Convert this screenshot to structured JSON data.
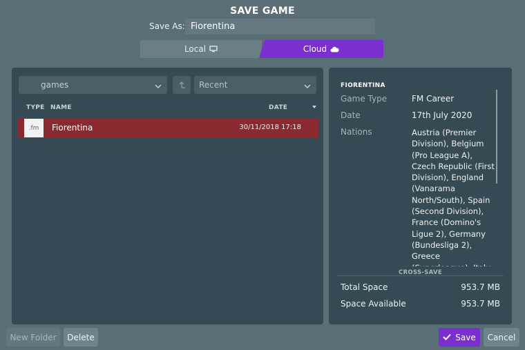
{
  "dialog": {
    "title": "SAVE GAME",
    "save_as_label": "Save As:",
    "save_as_value": "Fiorentina",
    "tabs": {
      "local": "Local",
      "cloud": "Cloud",
      "active": "cloud"
    }
  },
  "browser": {
    "folder": "games",
    "sort": "Recent",
    "columns": {
      "type": "TYPE",
      "name": "NAME",
      "date": "DATE"
    },
    "files": [
      {
        "type": ".fm",
        "name": "Fiorentina",
        "date": "30/11/2018 17:18"
      }
    ]
  },
  "details": {
    "title": "FIORENTINA",
    "game_type_label": "Game Type",
    "game_type_value": "FM Career",
    "date_label": "Date",
    "date_value": "17th July 2020",
    "nations_label": "Nations",
    "nations_value": "Austria (Premier Division), Belgium (Pro League A), Czech Republic (First Division), England (Vanarama North/South), Spain (Second Division), France (Domino's Ligue 2), Germany (Bundesliga 2), Greece (Superleague), Italy",
    "cross_save": "CROSS-SAVE",
    "total_space_label": "Total Space",
    "total_space_value": "953.7 MB",
    "space_available_label": "Space Available",
    "space_available_value": "953.7 MB"
  },
  "actions": {
    "new_folder": "New Folder",
    "delete": "Delete",
    "save": "Save",
    "cancel": "Cancel"
  },
  "colors": {
    "accent": "#7b2fd1",
    "selected_row": "#8a2a30",
    "panel": "#354a52",
    "background": "#5a6e76"
  }
}
